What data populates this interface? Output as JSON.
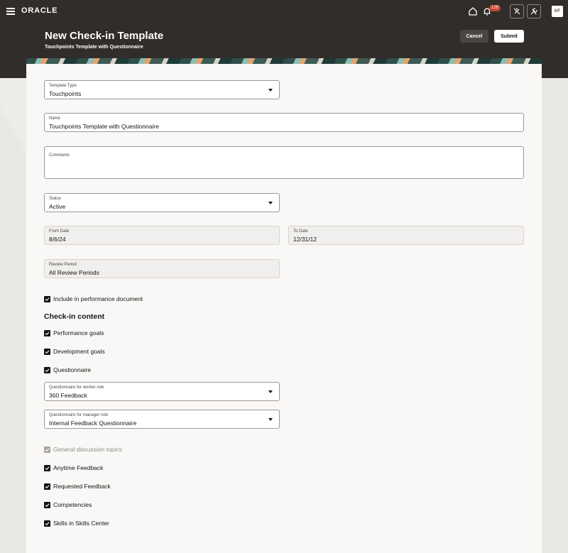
{
  "header": {
    "logo": "ORACLE",
    "notification_count": "128",
    "avatar_initials": "MF",
    "title": "New Check-in Template",
    "subtitle": "Touchpoints Template with Questionnaire",
    "cancel_label": "Cancel",
    "submit_label": "Submit"
  },
  "form": {
    "template_type": {
      "label": "Template Type",
      "value": "Touchpoints"
    },
    "name": {
      "label": "Name",
      "value": "Touchpoints Template with Questionnaire"
    },
    "comments": {
      "label": "Comments",
      "value": ""
    },
    "status": {
      "label": "Status",
      "value": "Active"
    },
    "from_date": {
      "label": "From Date",
      "value": "8/6/24"
    },
    "to_date": {
      "label": "To Date",
      "value": "12/31/12"
    },
    "review_period": {
      "label": "Review Period",
      "value": "All Review Periods"
    },
    "include_perf_doc": {
      "label": "Include in performance document",
      "checked": true
    },
    "checkin_content_title": "Check-in content",
    "performance_goals": {
      "label": "Performance goals",
      "checked": true
    },
    "development_goals": {
      "label": "Development goals",
      "checked": true
    },
    "questionnaire": {
      "label": "Questionnaire",
      "checked": true
    },
    "q_worker": {
      "label": "Questionnaire for worker role",
      "value": "360 Feedback"
    },
    "q_manager": {
      "label": "Questionnaire for manager role",
      "value": "Internal Feedback Questionnaire"
    },
    "general_discussion": {
      "label": "General discussion topics",
      "checked": true,
      "disabled": true
    },
    "anytime_feedback": {
      "label": "Anytime Feedback",
      "checked": true
    },
    "requested_feedback": {
      "label": "Requested Feedback",
      "checked": true
    },
    "competencies": {
      "label": "Competencies",
      "checked": true
    },
    "skills_center": {
      "label": "Skills in Skills Center",
      "checked": true
    }
  },
  "colors": {
    "header_bg": "#312d2a",
    "badge": "#c74634",
    "card_bg": "#f9f8f6"
  }
}
